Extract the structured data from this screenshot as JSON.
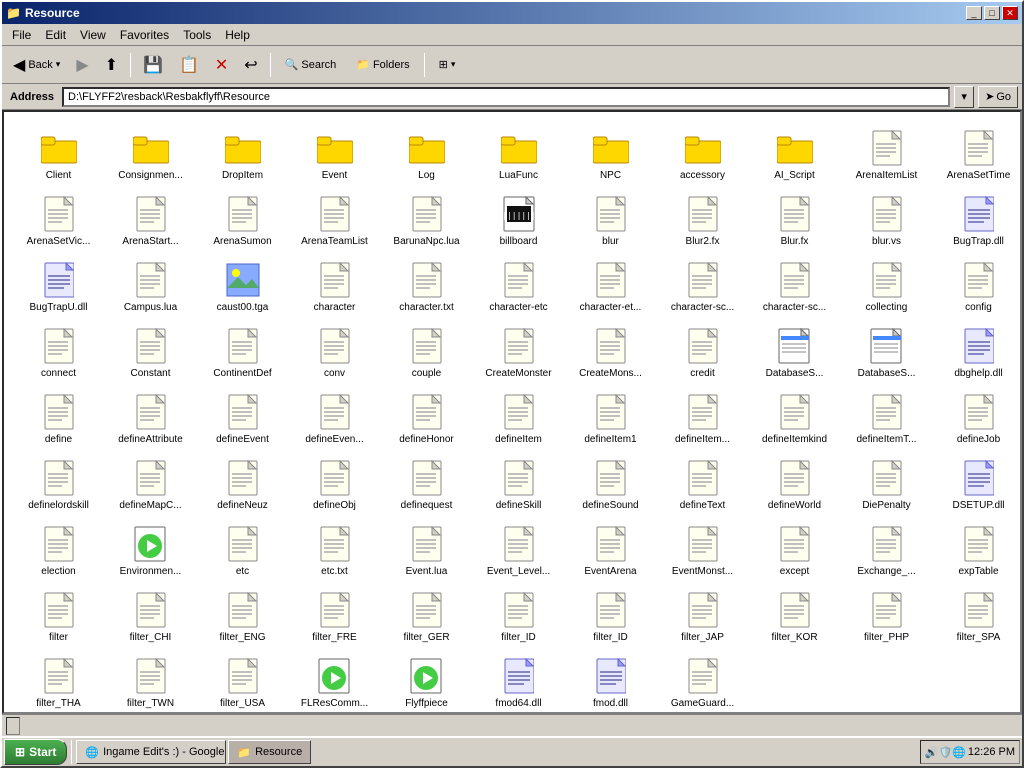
{
  "window": {
    "title": "Resource",
    "icon": "📁"
  },
  "titlebar": {
    "buttons": [
      "_",
      "□",
      "✕"
    ]
  },
  "menubar": {
    "items": [
      "File",
      "Edit",
      "View",
      "Favorites",
      "Tools",
      "Help"
    ]
  },
  "toolbar": {
    "back_label": "Back",
    "search_label": "Search",
    "folders_label": "Folders",
    "views_label": "▾"
  },
  "addressbar": {
    "label": "Address",
    "path": "D:\\FLYFF2\\resback\\Resbakflyff\\Resource",
    "go_label": "Go"
  },
  "files": [
    {
      "name": "Client",
      "type": "folder"
    },
    {
      "name": "Consignmen...",
      "type": "folder"
    },
    {
      "name": "DropItem",
      "type": "folder"
    },
    {
      "name": "Event",
      "type": "folder"
    },
    {
      "name": "Log",
      "type": "folder"
    },
    {
      "name": "LuaFunc",
      "type": "folder"
    },
    {
      "name": "NPC",
      "type": "folder"
    },
    {
      "name": "accessory",
      "type": "folder"
    },
    {
      "name": "AI_Script",
      "type": "folder"
    },
    {
      "name": "ArenaItemList",
      "type": "doc"
    },
    {
      "name": "ArenaSetTime",
      "type": "doc"
    },
    {
      "name": "ArenaSetVic...",
      "type": "doc"
    },
    {
      "name": "ArenaStart...",
      "type": "doc"
    },
    {
      "name": "ArenaSumon",
      "type": "doc"
    },
    {
      "name": "ArenaTeamList",
      "type": "doc"
    },
    {
      "name": "BarunaNpc.lua",
      "type": "doc"
    },
    {
      "name": "billboard",
      "type": "special"
    },
    {
      "name": "blur",
      "type": "doc"
    },
    {
      "name": "Blur2.fx",
      "type": "doc"
    },
    {
      "name": "Blur.fx",
      "type": "doc"
    },
    {
      "name": "blur.vs",
      "type": "doc"
    },
    {
      "name": "BugTrap.dll",
      "type": "dll"
    },
    {
      "name": "BugTrapU.dll",
      "type": "dll"
    },
    {
      "name": "Campus.lua",
      "type": "doc"
    },
    {
      "name": "caust00.tga",
      "type": "img"
    },
    {
      "name": "character",
      "type": "doc"
    },
    {
      "name": "character.txt",
      "type": "doc"
    },
    {
      "name": "character-etc",
      "type": "doc"
    },
    {
      "name": "character-et...",
      "type": "doc"
    },
    {
      "name": "character-sc...",
      "type": "doc"
    },
    {
      "name": "character-sc...",
      "type": "doc"
    },
    {
      "name": "collecting",
      "type": "doc"
    },
    {
      "name": "config",
      "type": "doc"
    },
    {
      "name": "connect",
      "type": "doc"
    },
    {
      "name": "Constant",
      "type": "doc"
    },
    {
      "name": "ContinentDef",
      "type": "doc"
    },
    {
      "name": "conv",
      "type": "doc"
    },
    {
      "name": "couple",
      "type": "doc"
    },
    {
      "name": "CreateMonster",
      "type": "doc"
    },
    {
      "name": "CreateMons...",
      "type": "doc"
    },
    {
      "name": "credit",
      "type": "doc"
    },
    {
      "name": "DatabaseS...",
      "type": "special2"
    },
    {
      "name": "DatabaseS...",
      "type": "special2"
    },
    {
      "name": "dbghelp.dll",
      "type": "dll"
    },
    {
      "name": "define",
      "type": "doc"
    },
    {
      "name": "defineAttribute",
      "type": "doc"
    },
    {
      "name": "defineEvent",
      "type": "doc"
    },
    {
      "name": "defineEven...",
      "type": "doc"
    },
    {
      "name": "defineHonor",
      "type": "doc"
    },
    {
      "name": "defineItem",
      "type": "doc"
    },
    {
      "name": "defineItem1",
      "type": "doc"
    },
    {
      "name": "defineItem...",
      "type": "doc"
    },
    {
      "name": "defineItemkind",
      "type": "doc"
    },
    {
      "name": "defineItemT...",
      "type": "doc"
    },
    {
      "name": "defineJob",
      "type": "doc"
    },
    {
      "name": "definelordskill",
      "type": "doc"
    },
    {
      "name": "defineMapC...",
      "type": "doc"
    },
    {
      "name": "defineNeuz",
      "type": "doc"
    },
    {
      "name": "defineObj",
      "type": "doc"
    },
    {
      "name": "definequest",
      "type": "doc"
    },
    {
      "name": "defineSkill",
      "type": "doc"
    },
    {
      "name": "defineSound",
      "type": "doc"
    },
    {
      "name": "defineText",
      "type": "doc"
    },
    {
      "name": "defineWorld",
      "type": "doc"
    },
    {
      "name": "DiePenalty",
      "type": "doc"
    },
    {
      "name": "DSETUP.dll",
      "type": "dll"
    },
    {
      "name": "election",
      "type": "doc"
    },
    {
      "name": "Environmen...",
      "type": "special3"
    },
    {
      "name": "etc",
      "type": "doc"
    },
    {
      "name": "etc.txt",
      "type": "doc"
    },
    {
      "name": "Event.lua",
      "type": "doc"
    },
    {
      "name": "Event_Level...",
      "type": "doc"
    },
    {
      "name": "EventArena",
      "type": "doc"
    },
    {
      "name": "EventMonst...",
      "type": "doc"
    },
    {
      "name": "except",
      "type": "doc"
    },
    {
      "name": "Exchange_...",
      "type": "doc"
    },
    {
      "name": "expTable",
      "type": "doc"
    },
    {
      "name": "filter",
      "type": "doc"
    },
    {
      "name": "filter_CHI",
      "type": "doc"
    },
    {
      "name": "filter_ENG",
      "type": "doc"
    },
    {
      "name": "filter_FRE",
      "type": "doc"
    },
    {
      "name": "filter_GER",
      "type": "doc"
    },
    {
      "name": "filter_ID",
      "type": "doc"
    },
    {
      "name": "filter_ID",
      "type": "doc"
    },
    {
      "name": "filter_JAP",
      "type": "doc"
    },
    {
      "name": "filter_KOR",
      "type": "doc"
    },
    {
      "name": "filter_PHP",
      "type": "doc"
    },
    {
      "name": "filter_SPA",
      "type": "doc"
    },
    {
      "name": "filter_THA",
      "type": "doc"
    },
    {
      "name": "filter_TWN",
      "type": "doc"
    },
    {
      "name": "filter_USA",
      "type": "doc"
    },
    {
      "name": "FLResComm...",
      "type": "special3"
    },
    {
      "name": "Flyffpiece",
      "type": "special3"
    },
    {
      "name": "fmod64.dll",
      "type": "dll"
    },
    {
      "name": "fmod.dll",
      "type": "dll"
    },
    {
      "name": "GameGuard...",
      "type": "doc"
    }
  ],
  "statusbar": {},
  "taskbar": {
    "start_label": "Start",
    "items": [
      {
        "label": "Ingame Edit's :) - Google...",
        "icon": "🌐",
        "active": false
      },
      {
        "label": "Resource",
        "icon": "📁",
        "active": true
      }
    ],
    "time": "12:26 PM",
    "tray_icons": "🔊🛡️"
  }
}
